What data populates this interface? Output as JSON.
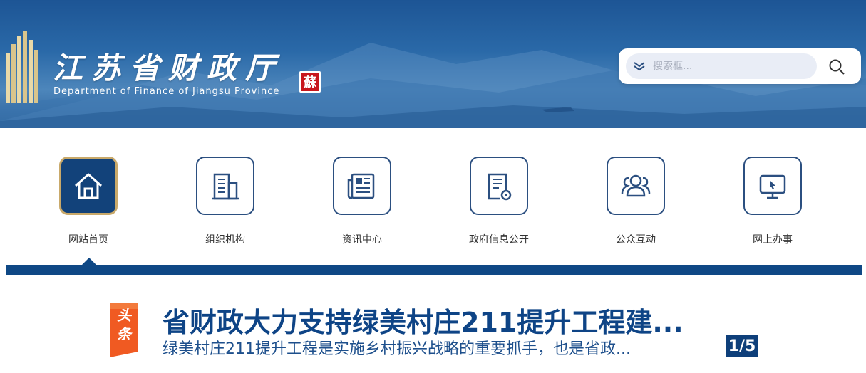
{
  "site": {
    "title_cn": "江苏省财政厅",
    "title_en": "Department of Finance of Jiangsu Province",
    "seal_char": "蘇"
  },
  "search": {
    "placeholder": "搜索框..."
  },
  "nav": {
    "items": [
      {
        "label": "网站首页",
        "icon": "home-icon",
        "active": true
      },
      {
        "label": "组织机构",
        "icon": "building-icon",
        "active": false
      },
      {
        "label": "资讯中心",
        "icon": "newspaper-icon",
        "active": false
      },
      {
        "label": "政府信息公开",
        "icon": "document-icon",
        "active": false
      },
      {
        "label": "公众互动",
        "icon": "people-icon",
        "active": false
      },
      {
        "label": "网上办事",
        "icon": "monitor-icon",
        "active": false
      }
    ]
  },
  "headline": {
    "badge": "头条",
    "title": "省财政大力支持绿美村庄211提升工程建...",
    "summary": "绿美村庄211提升工程是实施乡村振兴战略的重要抓手，也是省政...",
    "pager": "1/5"
  },
  "colors": {
    "primary": "#0f4885",
    "accent_gold": "#c9a96a",
    "badge_orange": "#f05a22"
  }
}
